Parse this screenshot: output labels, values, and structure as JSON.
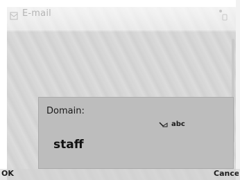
{
  "app": {
    "title": "E-mail",
    "icon": "mail-app-icon",
    "status_icon": "signal-icon"
  },
  "dialog": {
    "label": "Domain:",
    "value": "staff",
    "input_mode": {
      "icon": "pencil-icon",
      "label": "abc"
    }
  },
  "softkeys": {
    "left": "OK",
    "right": "Cancel"
  },
  "colors": {
    "dialog_bg": "#bdbdbd",
    "background": "#d6d6d6",
    "title_text": "#b5b5b5"
  }
}
